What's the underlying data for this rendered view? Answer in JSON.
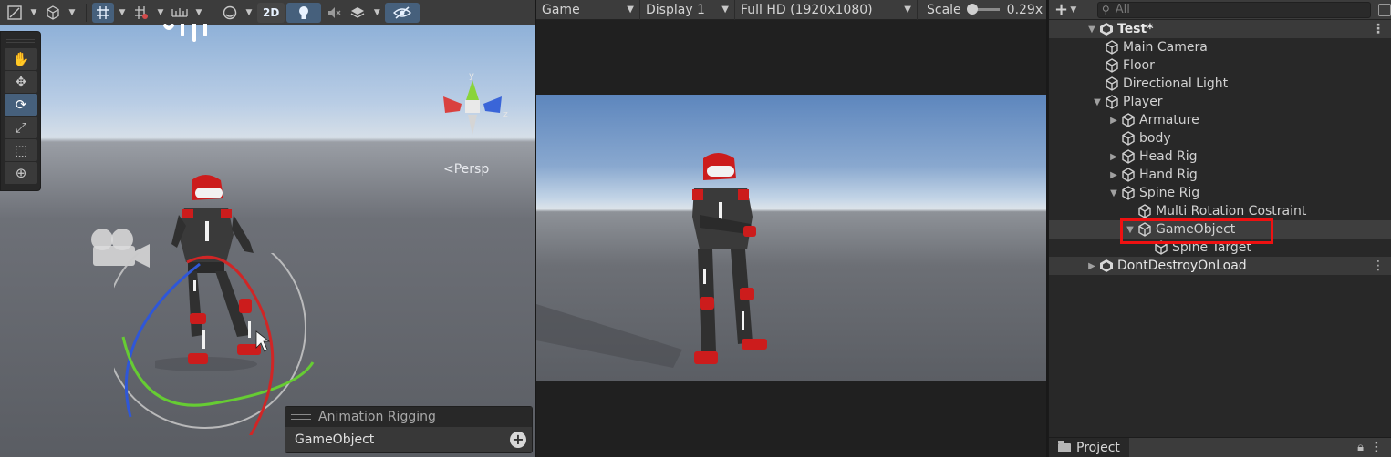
{
  "scene_view": {
    "toolbar": {
      "draw_mode_icon": "shaded-draw-icon",
      "render_mode_icon": "cube-render-icon",
      "grid_snap_icon": "grid-snap-icon",
      "increment_snap_icon": "increment-snap-icon",
      "ruler_icon": "ruler-icon",
      "sphere_icon": "sphere-shading-icon",
      "mode_2d": "2D",
      "light_icon": "lightbulb-icon",
      "audio_icon": "mute-audio-icon",
      "effects_icon": "effects-layers-icon",
      "visibility_icon": "hidden-eye-icon"
    },
    "tools": [
      "hand-tool",
      "move-tool",
      "rotate-tool",
      "scale-tool",
      "rect-tool",
      "transform-tool"
    ],
    "active_tool": "rotate-tool",
    "gizmo_labels": {
      "y": "y",
      "x": "x",
      "z": "z"
    },
    "persp_label": "<Persp",
    "overlay": {
      "title": "Animation Rigging",
      "field_value": "GameObject",
      "add_symbol": "+"
    }
  },
  "game_view": {
    "tab_label": "Game",
    "display": "Display 1",
    "resolution": "Full HD (1920x1080)",
    "scale_label": "Scale",
    "scale_value": "0.29x"
  },
  "hierarchy": {
    "add_symbol": "+",
    "search_placeholder": "All",
    "scene_name": "Test*",
    "items": [
      {
        "label": "Main Camera",
        "depth": 1,
        "fold": ""
      },
      {
        "label": "Floor",
        "depth": 1,
        "fold": ""
      },
      {
        "label": "Directional Light",
        "depth": 1,
        "fold": ""
      },
      {
        "label": "Player",
        "depth": 1,
        "fold": "open"
      },
      {
        "label": "Armature",
        "depth": 2,
        "fold": "closed"
      },
      {
        "label": "body",
        "depth": 2,
        "fold": ""
      },
      {
        "label": "Head Rig",
        "depth": 2,
        "fold": "closed"
      },
      {
        "label": "Hand Rig",
        "depth": 2,
        "fold": "closed"
      },
      {
        "label": "Spine Rig",
        "depth": 2,
        "fold": "open"
      },
      {
        "label": "Multi Rotation Costraint",
        "depth": 3,
        "fold": ""
      },
      {
        "label": "GameObject",
        "depth": 3,
        "fold": "open",
        "selected": true
      },
      {
        "label": "Spine Target",
        "depth": 4,
        "fold": ""
      }
    ],
    "second_scene": "DontDestroyOnLoad",
    "project_tab": "Project"
  }
}
